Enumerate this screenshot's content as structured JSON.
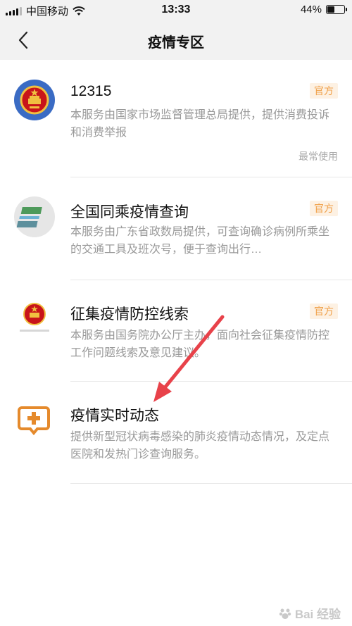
{
  "status_bar": {
    "carrier": "中国移动",
    "time": "13:33",
    "battery": "44%",
    "battery_level": 0.44
  },
  "nav": {
    "title": "疫情专区"
  },
  "items": [
    {
      "title": "12315",
      "badge": "官方",
      "desc": "本服务由国家市场监督管理总局提供，提供消费投诉和消费举报",
      "meta": "最常使用",
      "icon": "national-emblem-icon"
    },
    {
      "title": "全国同乘疫情查询",
      "badge": "官方",
      "desc": "本服务由广东省政数局提供，可查询确诊病例所乘坐的交通工具及班次号，便于查询出行…",
      "icon": "guangdong-gov-logo-icon"
    },
    {
      "title": "征集疫情防控线索",
      "badge": "官方",
      "desc": "本服务由国务院办公厅主办，面向社会征集疫情防控工作问题线索及意见建议。",
      "icon": "gov-cn-emblem-icon"
    },
    {
      "title": "疫情实时动态",
      "desc": "提供新型冠状病毒感染的肺炎疫情动态情况，及定点医院和发热门诊查询服务。",
      "icon": "medical-chat-icon"
    }
  ],
  "watermark": {
    "text": "Bai 经验"
  },
  "colors": {
    "badge_text": "#f0a048",
    "badge_bg": "#fdf1e3",
    "arrow": "#e8424a"
  }
}
